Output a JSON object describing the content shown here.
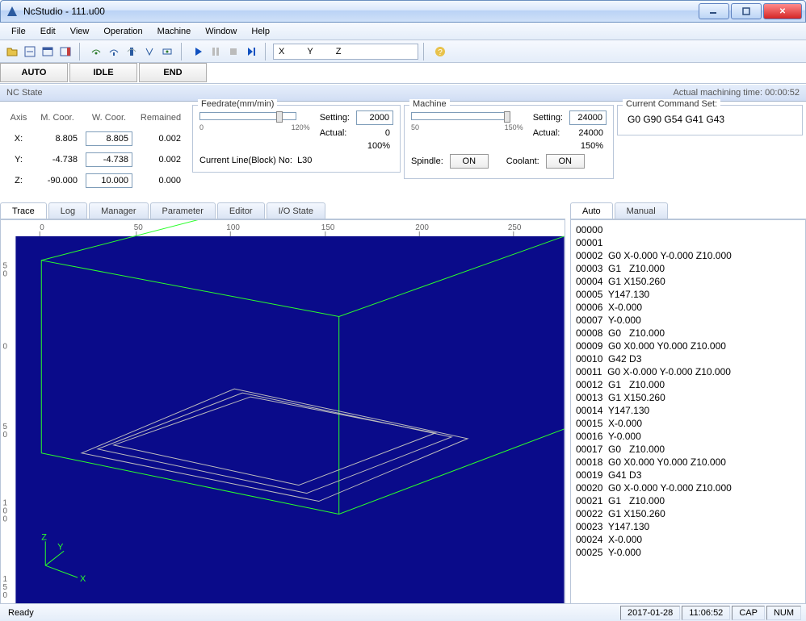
{
  "title": "NcStudio  - 111.u00",
  "menus": [
    "File",
    "Edit",
    "View",
    "Operation",
    "Machine",
    "Window",
    "Help"
  ],
  "modes": [
    "AUTO",
    "IDLE",
    "END"
  ],
  "ncstate_label": "NC State",
  "machining_time_label": "Actual machining time:",
  "machining_time": "00:00:52",
  "coord": {
    "headers": [
      "Axis",
      "M. Coor.",
      "W. Coor.",
      "Remained"
    ],
    "rows": [
      {
        "axis": "X:",
        "m": "8.805",
        "w": "8.805",
        "r": "0.002"
      },
      {
        "axis": "Y:",
        "m": "-4.738",
        "w": "-4.738",
        "r": "0.002"
      },
      {
        "axis": "Z:",
        "m": "-90.000",
        "w": "10.000",
        "r": "0.000"
      }
    ]
  },
  "feedrate": {
    "legend": "Feedrate(mm/min)",
    "scale_min": "0",
    "scale_max": "120%",
    "setting_label": "Setting:",
    "setting": "2000",
    "actual_label": "Actual:",
    "actual": "0",
    "percent": "100%",
    "line_label": "Current Line(Block) No:",
    "line": "L30"
  },
  "machine": {
    "legend": "Machine",
    "scale_min": "50",
    "scale_max": "150%",
    "setting_label": "Setting:",
    "setting": "24000",
    "actual_label": "Actual:",
    "actual": "24000",
    "percent": "150%",
    "spindle_label": "Spindle:",
    "spindle_btn": "ON",
    "coolant_label": "Coolant:",
    "coolant_btn": "ON"
  },
  "cmdset": {
    "legend": "Current Command Set:",
    "text": "G0 G90 G54 G41 G43"
  },
  "toolbar_coord_labels": [
    "X",
    "Y",
    "Z"
  ],
  "tabs_left": [
    "Trace",
    "Log",
    "Manager",
    "Parameter",
    "Editor",
    "I/O State"
  ],
  "tabs_right": [
    "Auto",
    "Manual"
  ],
  "ruler_ticks_x": [
    "0",
    "50",
    "100",
    "150",
    "200",
    "250"
  ],
  "ruler_ticks_y": [
    "50",
    "0",
    "50",
    "100",
    "150"
  ],
  "code": [
    "00000",
    "00001",
    "00002  G0 X-0.000 Y-0.000 Z10.000",
    "00003  G1   Z10.000",
    "00004  G1 X150.260",
    "00005  Y147.130",
    "00006  X-0.000",
    "00007  Y-0.000",
    "00008  G0   Z10.000",
    "00009  G0 X0.000 Y0.000 Z10.000",
    "00010  G42 D3",
    "00011  G0 X-0.000 Y-0.000 Z10.000",
    "00012  G1   Z10.000",
    "00013  G1 X150.260",
    "00014  Y147.130",
    "00015  X-0.000",
    "00016  Y-0.000",
    "00017  G0   Z10.000",
    "00018  G0 X0.000 Y0.000 Z10.000",
    "00019  G41 D3",
    "00020  G0 X-0.000 Y-0.000 Z10.000",
    "00021  G1   Z10.000",
    "00022  G1 X150.260",
    "00023  Y147.130",
    "00024  X-0.000",
    "00025  Y-0.000"
  ],
  "status": {
    "ready": "Ready",
    "date": "2017-01-28",
    "time": "11:06:52",
    "cap": "CAP",
    "num": "NUM"
  }
}
